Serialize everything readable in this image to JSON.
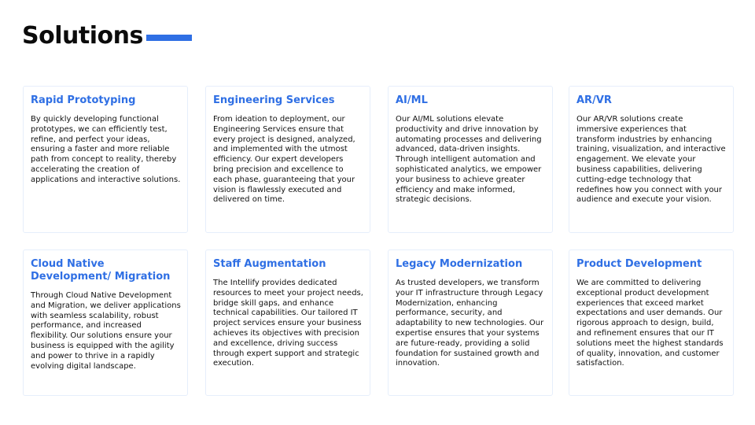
{
  "page": {
    "title": "Solutions",
    "accent_color": "#2f6fe4"
  },
  "cards": [
    {
      "title": "Rapid Prototyping",
      "body": "By quickly developing functional prototypes, we can efficiently test, refine, and perfect your ideas, ensuring a faster and more reliable path from concept to reality, thereby accelerating the creation of applications and interactive solutions."
    },
    {
      "title": "Engineering Services",
      "body": "From ideation to deployment, our Engineering Services ensure that every project is designed, analyzed, and implemented with the utmost efficiency. Our expert developers bring precision and excellence to each phase, guaranteeing that your vision is flawlessly executed and delivered on time."
    },
    {
      "title": "AI/ML",
      "body": "Our AI/ML solutions elevate productivity and drive innovation by automating processes and delivering advanced, data-driven insights. Through intelligent automation and sophisticated analytics, we empower your business to achieve greater efficiency and make informed, strategic decisions."
    },
    {
      "title": "AR/VR",
      "body": "Our AR/VR solutions create immersive experiences that transform industries by enhancing training, visualization, and interactive engagement. We elevate your business capabilities, delivering cutting-edge technology that redefines how you connect with your audience and execute your vision."
    },
    {
      "title": "Cloud Native Development/ Migration",
      "body": "Through Cloud Native Development and Migration, we deliver applications with seamless scalability, robust performance, and increased flexibility. Our solutions ensure your business is equipped with the agility and power to thrive in a rapidly evolving digital landscape."
    },
    {
      "title": "Staff Augmentation",
      "body": "The Intellify provides dedicated resources to meet your project needs, bridge skill gaps, and enhance technical capabilities. Our tailored IT project services ensure your business achieves its objectives with precision and excellence, driving success through expert support and strategic execution."
    },
    {
      "title": "Legacy Modernization",
      "body": "As trusted developers, we transform your IT infrastructure through Legacy Modernization, enhancing performance, security, and adaptability to new technologies. Our expertise ensures that your systems are future-ready, providing a solid foundation for sustained growth and innovation."
    },
    {
      "title": "Product Development",
      "body": "We are committed to delivering exceptional product development experiences that exceed market expectations and user demands. Our rigorous approach to design, build, and refinement ensures that our IT solutions meet the highest standards of quality, innovation, and customer satisfaction."
    }
  ]
}
